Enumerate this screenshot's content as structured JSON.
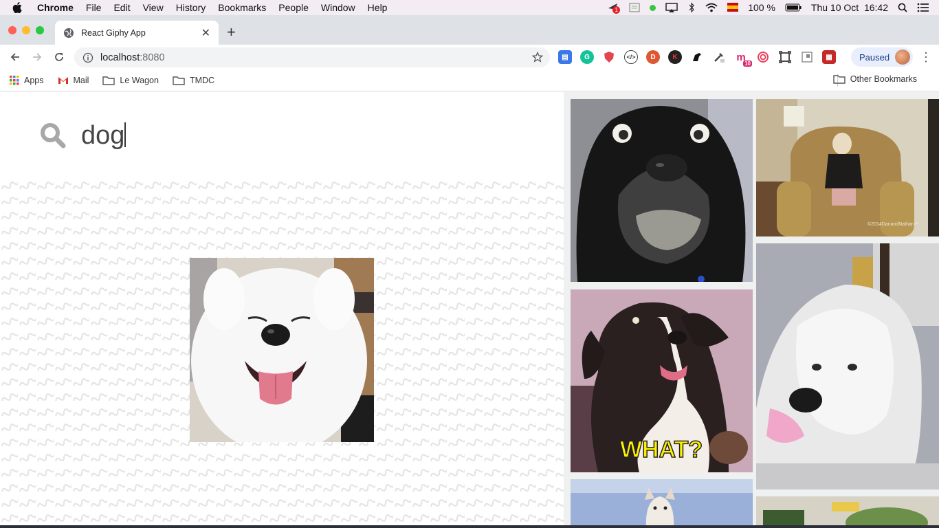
{
  "menubar": {
    "app_name": "Chrome",
    "items": [
      "File",
      "Edit",
      "View",
      "History",
      "Bookmarks",
      "People",
      "Window",
      "Help"
    ],
    "battery": "100 %",
    "clock": "Thu 10 Oct  16:42",
    "badge_count": "1"
  },
  "tab": {
    "title": "React Giphy App"
  },
  "address": {
    "host": "localhost",
    "port": ":8080"
  },
  "profile": {
    "label": "Paused"
  },
  "extensions": {
    "mail_badge": "10"
  },
  "bookmarks": {
    "items": [
      "Apps",
      "Mail",
      "Le Wagon",
      "TMDC"
    ],
    "other": "Other Bookmarks"
  },
  "search": {
    "value": "dog"
  },
  "gifs": {
    "caption_what": "WHAT?",
    "watermark": "©2014DanandNathan™"
  }
}
